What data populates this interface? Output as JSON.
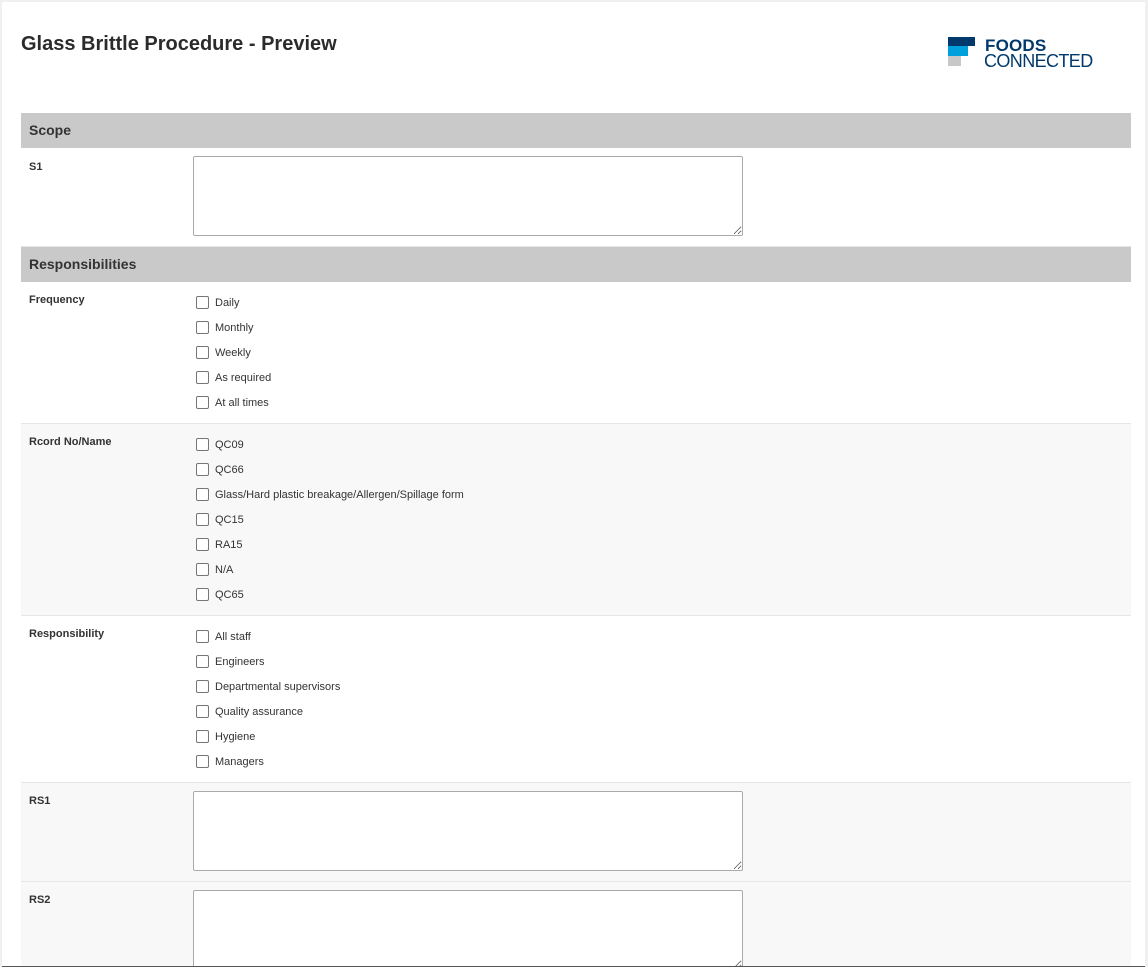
{
  "header": {
    "title": "Glass Brittle Procedure - Preview",
    "logo_line1": "FOODS",
    "logo_line2": "CONNECTED"
  },
  "sections": {
    "scope": {
      "title": "Scope",
      "s1_label": "S1"
    },
    "responsibilities": {
      "title": "Responsibilities",
      "frequency": {
        "label": "Frequency",
        "options": [
          "Daily",
          "Monthly",
          "Weekly",
          "As required",
          "At all times"
        ]
      },
      "record": {
        "label": "Rcord No/Name",
        "options": [
          "QC09",
          "QC66",
          "Glass/Hard plastic breakage/Allergen/Spillage form",
          "QC15",
          "RA15",
          "N/A",
          "QC65"
        ]
      },
      "responsibility": {
        "label": "Responsibility",
        "options": [
          "All staff",
          "Engineers",
          "Departmental supervisors",
          "Quality assurance",
          "Hygiene",
          "Managers"
        ]
      },
      "rs1_label": "RS1",
      "rs2_label": "RS2"
    }
  },
  "colors": {
    "section_header_bg": "#c9c9c9",
    "logo_navy": "#003a6c",
    "logo_cyan": "#00a0dc",
    "logo_grey": "#c8c8c8"
  }
}
